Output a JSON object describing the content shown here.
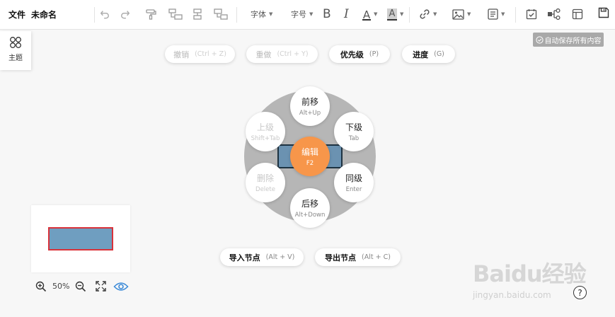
{
  "menu": {
    "file": "文件",
    "doc_title": "未命名"
  },
  "toolbar": {
    "font_label": "字体",
    "size_label": "字号",
    "bold_glyph": "B",
    "italic_glyph": "I",
    "font_color_glyph": "A",
    "bg_color_glyph": "A"
  },
  "theme": {
    "label": "主题"
  },
  "autosave": {
    "label": "自动保存所有内容"
  },
  "top_pills": {
    "undo": {
      "label": "撤销",
      "shortcut": "(Ctrl + Z)"
    },
    "redo": {
      "label": "重做",
      "shortcut": "(Ctrl + Y)"
    },
    "priority": {
      "label": "优先级",
      "shortcut": "(P)"
    },
    "progress": {
      "label": "进度",
      "shortcut": "(G)"
    }
  },
  "radial": {
    "forward": {
      "label": "前移",
      "shortcut": "Alt+Up"
    },
    "child": {
      "label": "下级",
      "shortcut": "Tab"
    },
    "sibling": {
      "label": "同级",
      "shortcut": "Enter"
    },
    "backward": {
      "label": "后移",
      "shortcut": "Alt+Down"
    },
    "delete": {
      "label": "删除",
      "shortcut": "Delete"
    },
    "parent": {
      "label": "上级",
      "shortcut": "Shift+Tab"
    },
    "edit": {
      "label": "编辑",
      "shortcut": "F2"
    }
  },
  "bottom_pills": {
    "import": {
      "label": "导入节点",
      "shortcut": "(Alt + V)"
    },
    "export": {
      "label": "导出节点",
      "shortcut": "(Alt + C)"
    }
  },
  "zoom": {
    "level": "50%"
  },
  "watermark": {
    "brand": "Baidu经验",
    "url": "jingyan.baidu.com"
  },
  "help": {
    "glyph": "?"
  },
  "colors": {
    "accent_orange": "#f7964a",
    "node_fill": "#6b92b1",
    "ring_gray": "#9c9c9c",
    "eye_blue": "#3d8bd8",
    "minimap_border": "#d9323a"
  }
}
